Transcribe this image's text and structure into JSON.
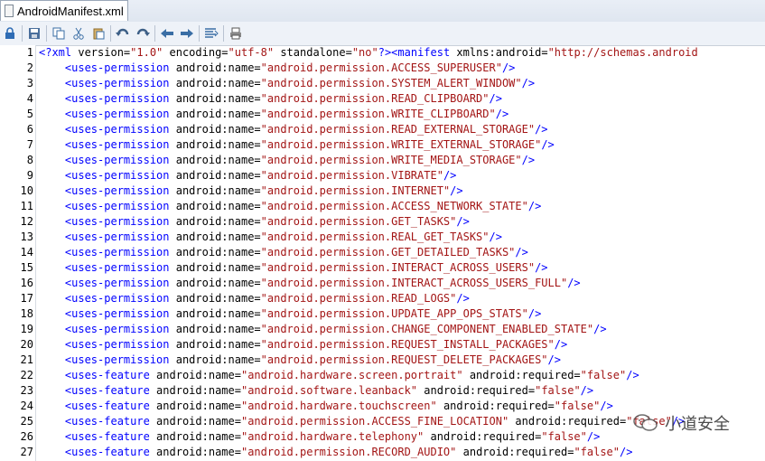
{
  "tab": {
    "title": "AndroidManifest.xml"
  },
  "toolbar": {
    "buttons": [
      "lock-icon",
      "save-icon",
      "copy-icon",
      "cut-icon",
      "paste-icon",
      "undo-icon",
      "redo-icon",
      "back-icon",
      "forward-icon",
      "format-icon",
      "print-icon"
    ]
  },
  "lines": [
    {
      "n": "1",
      "parts": [
        [
          "decl",
          "<?xml "
        ],
        [
          "attr",
          "version="
        ],
        [
          "str",
          "\"1.0\""
        ],
        [
          "attr",
          " encoding="
        ],
        [
          "str",
          "\"utf-8\""
        ],
        [
          "attr",
          " standalone="
        ],
        [
          "str",
          "\"no\""
        ],
        [
          "decl",
          "?>"
        ],
        [
          "tag",
          "<manifest "
        ],
        [
          "attr",
          "xmlns:android="
        ],
        [
          "str",
          "\"http://schemas.android"
        ]
      ]
    },
    {
      "n": "2",
      "parts": [
        [
          "tag",
          "    <uses-permission "
        ],
        [
          "attr",
          "android:name="
        ],
        [
          "str",
          "\"android.permission.ACCESS_SUPERUSER\""
        ],
        [
          "tag",
          "/>"
        ]
      ]
    },
    {
      "n": "3",
      "parts": [
        [
          "tag",
          "    <uses-permission "
        ],
        [
          "attr",
          "android:name="
        ],
        [
          "str",
          "\"android.permission.SYSTEM_ALERT_WINDOW\""
        ],
        [
          "tag",
          "/>"
        ]
      ]
    },
    {
      "n": "4",
      "parts": [
        [
          "tag",
          "    <uses-permission "
        ],
        [
          "attr",
          "android:name="
        ],
        [
          "str",
          "\"android.permission.READ_CLIPBOARD\""
        ],
        [
          "tag",
          "/>"
        ]
      ]
    },
    {
      "n": "5",
      "parts": [
        [
          "tag",
          "    <uses-permission "
        ],
        [
          "attr",
          "android:name="
        ],
        [
          "str",
          "\"android.permission.WRITE_CLIPBOARD\""
        ],
        [
          "tag",
          "/>"
        ]
      ]
    },
    {
      "n": "6",
      "parts": [
        [
          "tag",
          "    <uses-permission "
        ],
        [
          "attr",
          "android:name="
        ],
        [
          "str",
          "\"android.permission.READ_EXTERNAL_STORAGE\""
        ],
        [
          "tag",
          "/>"
        ]
      ]
    },
    {
      "n": "7",
      "parts": [
        [
          "tag",
          "    <uses-permission "
        ],
        [
          "attr",
          "android:name="
        ],
        [
          "str",
          "\"android.permission.WRITE_EXTERNAL_STORAGE\""
        ],
        [
          "tag",
          "/>"
        ]
      ]
    },
    {
      "n": "8",
      "parts": [
        [
          "tag",
          "    <uses-permission "
        ],
        [
          "attr",
          "android:name="
        ],
        [
          "str",
          "\"android.permission.WRITE_MEDIA_STORAGE\""
        ],
        [
          "tag",
          "/>"
        ]
      ]
    },
    {
      "n": "9",
      "parts": [
        [
          "tag",
          "    <uses-permission "
        ],
        [
          "attr",
          "android:name="
        ],
        [
          "str",
          "\"android.permission.VIBRATE\""
        ],
        [
          "tag",
          "/>"
        ]
      ]
    },
    {
      "n": "10",
      "parts": [
        [
          "tag",
          "    <uses-permission "
        ],
        [
          "attr",
          "android:name="
        ],
        [
          "str",
          "\"android.permission.INTERNET\""
        ],
        [
          "tag",
          "/>"
        ]
      ]
    },
    {
      "n": "11",
      "parts": [
        [
          "tag",
          "    <uses-permission "
        ],
        [
          "attr",
          "android:name="
        ],
        [
          "str",
          "\"android.permission.ACCESS_NETWORK_STATE\""
        ],
        [
          "tag",
          "/>"
        ]
      ]
    },
    {
      "n": "12",
      "parts": [
        [
          "tag",
          "    <uses-permission "
        ],
        [
          "attr",
          "android:name="
        ],
        [
          "str",
          "\"android.permission.GET_TASKS\""
        ],
        [
          "tag",
          "/>"
        ]
      ]
    },
    {
      "n": "13",
      "parts": [
        [
          "tag",
          "    <uses-permission "
        ],
        [
          "attr",
          "android:name="
        ],
        [
          "str",
          "\"android.permission.REAL_GET_TASKS\""
        ],
        [
          "tag",
          "/>"
        ]
      ]
    },
    {
      "n": "14",
      "parts": [
        [
          "tag",
          "    <uses-permission "
        ],
        [
          "attr",
          "android:name="
        ],
        [
          "str",
          "\"android.permission.GET_DETAILED_TASKS\""
        ],
        [
          "tag",
          "/>"
        ]
      ]
    },
    {
      "n": "15",
      "parts": [
        [
          "tag",
          "    <uses-permission "
        ],
        [
          "attr",
          "android:name="
        ],
        [
          "str",
          "\"android.permission.INTERACT_ACROSS_USERS\""
        ],
        [
          "tag",
          "/>"
        ]
      ]
    },
    {
      "n": "16",
      "parts": [
        [
          "tag",
          "    <uses-permission "
        ],
        [
          "attr",
          "android:name="
        ],
        [
          "str",
          "\"android.permission.INTERACT_ACROSS_USERS_FULL\""
        ],
        [
          "tag",
          "/>"
        ]
      ]
    },
    {
      "n": "17",
      "parts": [
        [
          "tag",
          "    <uses-permission "
        ],
        [
          "attr",
          "android:name="
        ],
        [
          "str",
          "\"android.permission.READ_LOGS\""
        ],
        [
          "tag",
          "/>"
        ]
      ]
    },
    {
      "n": "18",
      "parts": [
        [
          "tag",
          "    <uses-permission "
        ],
        [
          "attr",
          "android:name="
        ],
        [
          "str",
          "\"android.permission.UPDATE_APP_OPS_STATS\""
        ],
        [
          "tag",
          "/>"
        ]
      ]
    },
    {
      "n": "19",
      "parts": [
        [
          "tag",
          "    <uses-permission "
        ],
        [
          "attr",
          "android:name="
        ],
        [
          "str",
          "\"android.permission.CHANGE_COMPONENT_ENABLED_STATE\""
        ],
        [
          "tag",
          "/>"
        ]
      ]
    },
    {
      "n": "20",
      "parts": [
        [
          "tag",
          "    <uses-permission "
        ],
        [
          "attr",
          "android:name="
        ],
        [
          "str",
          "\"android.permission.REQUEST_INSTALL_PACKAGES\""
        ],
        [
          "tag",
          "/>"
        ]
      ]
    },
    {
      "n": "21",
      "parts": [
        [
          "tag",
          "    <uses-permission "
        ],
        [
          "attr",
          "android:name="
        ],
        [
          "str",
          "\"android.permission.REQUEST_DELETE_PACKAGES\""
        ],
        [
          "tag",
          "/>"
        ]
      ]
    },
    {
      "n": "22",
      "parts": [
        [
          "tag",
          "    <uses-feature "
        ],
        [
          "attr",
          "android:name="
        ],
        [
          "str",
          "\"android.hardware.screen.portrait\""
        ],
        [
          "attr",
          " android:required="
        ],
        [
          "str",
          "\"false\""
        ],
        [
          "tag",
          "/>"
        ]
      ]
    },
    {
      "n": "23",
      "parts": [
        [
          "tag",
          "    <uses-feature "
        ],
        [
          "attr",
          "android:name="
        ],
        [
          "str",
          "\"android.software.leanback\""
        ],
        [
          "attr",
          " android:required="
        ],
        [
          "str",
          "\"false\""
        ],
        [
          "tag",
          "/>"
        ]
      ]
    },
    {
      "n": "24",
      "parts": [
        [
          "tag",
          "    <uses-feature "
        ],
        [
          "attr",
          "android:name="
        ],
        [
          "str",
          "\"android.hardware.touchscreen\""
        ],
        [
          "attr",
          " android:required="
        ],
        [
          "str",
          "\"false\""
        ],
        [
          "tag",
          "/>"
        ]
      ]
    },
    {
      "n": "25",
      "parts": [
        [
          "tag",
          "    <uses-feature "
        ],
        [
          "attr",
          "android:name="
        ],
        [
          "str",
          "\"android.permission.ACCESS_FINE_LOCATION\""
        ],
        [
          "attr",
          " android:required="
        ],
        [
          "str",
          "\"false\""
        ],
        [
          "tag",
          "/>"
        ]
      ]
    },
    {
      "n": "26",
      "parts": [
        [
          "tag",
          "    <uses-feature "
        ],
        [
          "attr",
          "android:name="
        ],
        [
          "str",
          "\"android.hardware.telephony\""
        ],
        [
          "attr",
          " android:required="
        ],
        [
          "str",
          "\"false\""
        ],
        [
          "tag",
          "/>"
        ]
      ]
    },
    {
      "n": "27",
      "parts": [
        [
          "tag",
          "    <uses-feature "
        ],
        [
          "attr",
          "android:name="
        ],
        [
          "str",
          "\"android.permission.RECORD_AUDIO\""
        ],
        [
          "attr",
          " android:required="
        ],
        [
          "str",
          "\"false\""
        ],
        [
          "tag",
          "/>"
        ]
      ]
    }
  ],
  "watermark": {
    "text": "小道安全"
  }
}
